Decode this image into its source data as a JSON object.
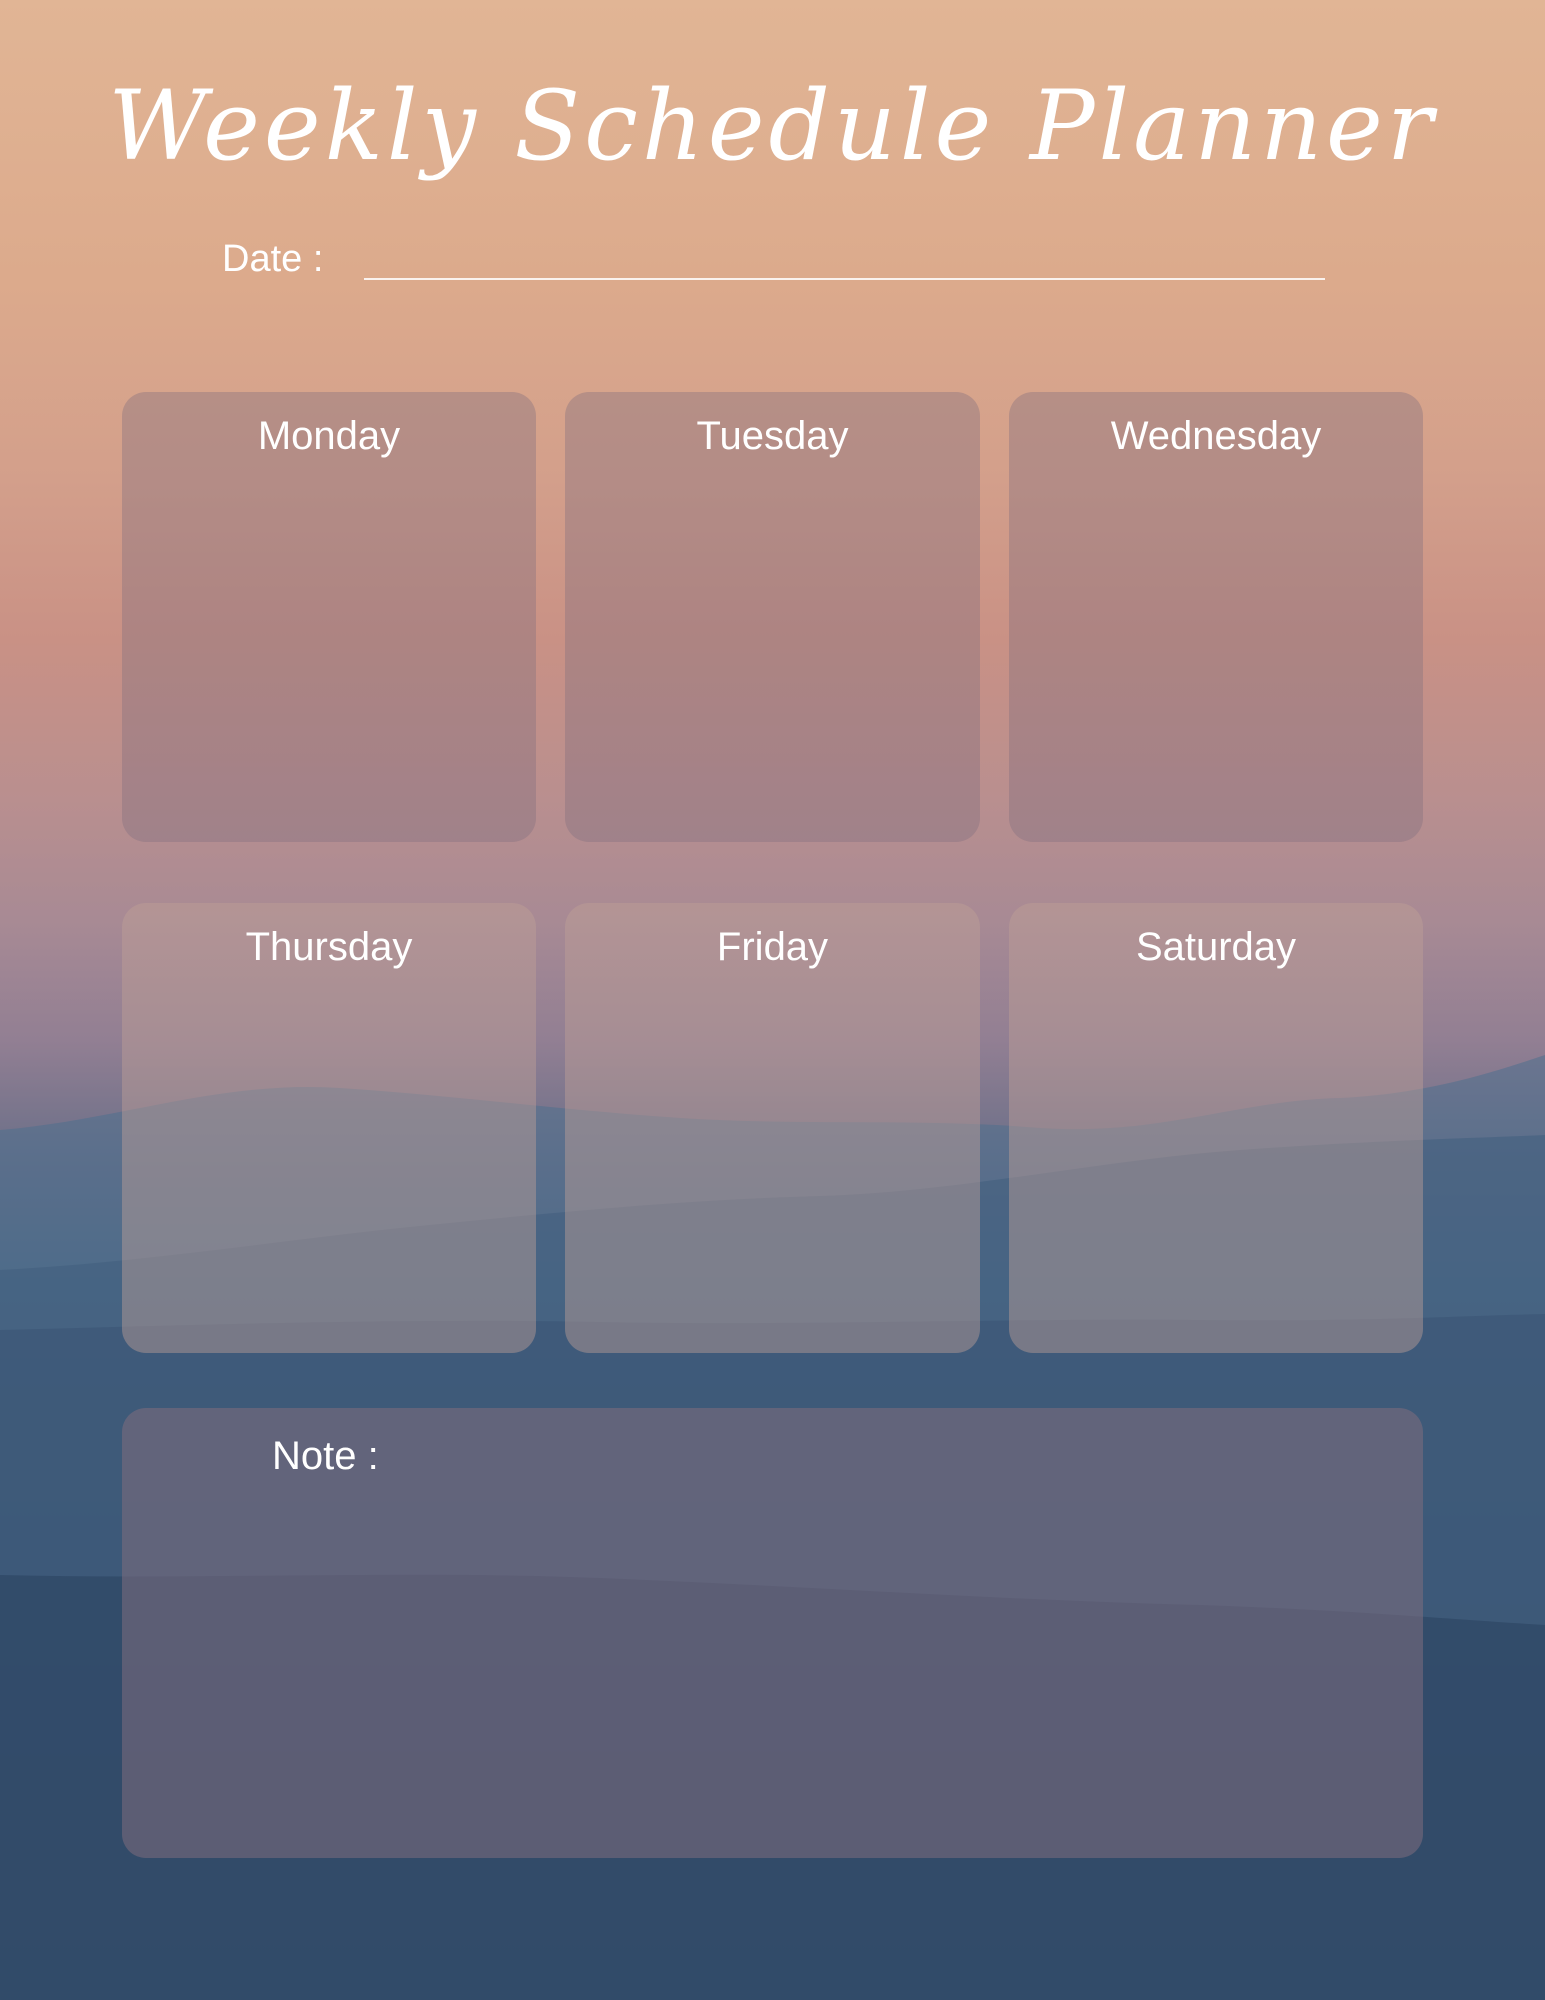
{
  "planner": {
    "title": "Weekly Schedule Planner",
    "date_label": "Date :",
    "days": [
      "Monday",
      "Tuesday",
      "Wednesday",
      "Thursday",
      "Friday",
      "Saturday"
    ],
    "note_label": "Note :"
  }
}
